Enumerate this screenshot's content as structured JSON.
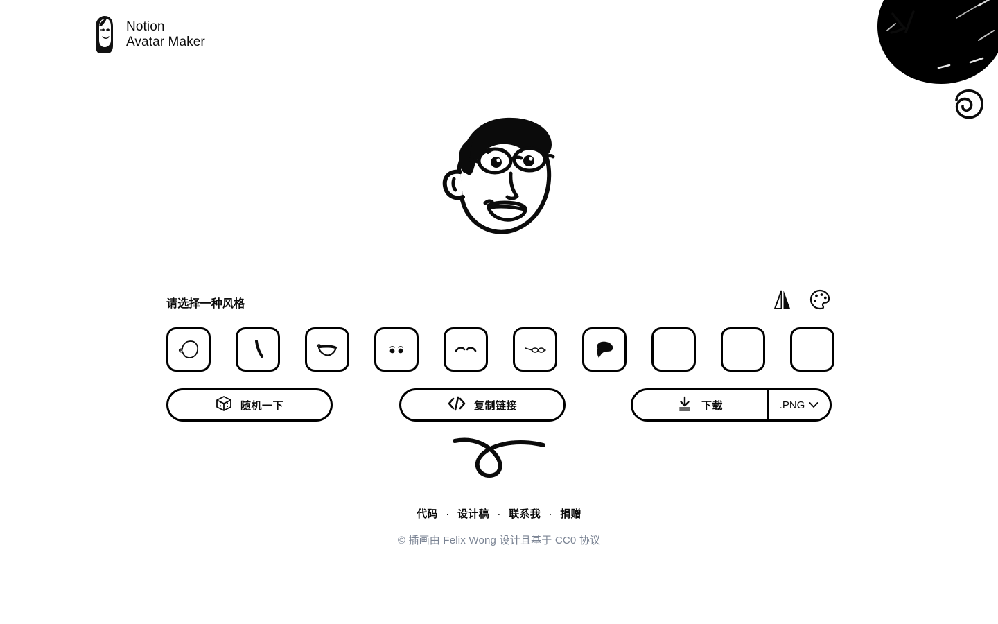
{
  "brand": {
    "logo_icon": "notion-avatar-logo",
    "line1": "Notion",
    "line2": "Avatar Maker"
  },
  "preview": {
    "name": "avatar-preview",
    "description": "hand-drawn face with swept hair, glasses and smile"
  },
  "panel": {
    "title": "请选择一种风格",
    "tools": [
      {
        "name": "flip-icon",
        "label": "翻转"
      },
      {
        "name": "palette-icon",
        "label": "调色"
      }
    ],
    "chips": [
      {
        "name": "style-chip-face",
        "icon": "face-icon"
      },
      {
        "name": "style-chip-nose",
        "icon": "nose-icon"
      },
      {
        "name": "style-chip-mouth",
        "icon": "mouth-icon"
      },
      {
        "name": "style-chip-eyes",
        "icon": "eyes-icon"
      },
      {
        "name": "style-chip-eyebrows",
        "icon": "eyebrows-icon"
      },
      {
        "name": "style-chip-glasses",
        "icon": "glasses-icon"
      },
      {
        "name": "style-chip-hair",
        "icon": "hair-icon"
      },
      {
        "name": "style-chip-beard",
        "icon": "empty-icon"
      },
      {
        "name": "style-chip-accessory",
        "icon": "empty-icon"
      },
      {
        "name": "style-chip-details",
        "icon": "empty-icon"
      }
    ]
  },
  "actions": {
    "random_label": "随机一下",
    "random_icon": "dice-icon",
    "copy_label": "复制链接",
    "copy_icon": "code-icon",
    "download_label": "下载",
    "download_icon": "download-icon",
    "format_value": ".PNG",
    "format_caret_icon": "chevron-down-icon"
  },
  "footer": {
    "links": [
      "代码",
      "设计稿",
      "联系我",
      "捐赠"
    ],
    "separator": "·",
    "copyright": "© 插画由 Felix Wong 设计且基于 CC0 协议"
  },
  "decorations": [
    {
      "name": "ink-blob-decoration"
    },
    {
      "name": "tick-marks-decoration"
    },
    {
      "name": "spiral-decoration"
    },
    {
      "name": "loop-flourish-decoration"
    }
  ],
  "colors": {
    "ink": "#0b0b0b",
    "background": "#ffffff",
    "muted_text": "#7b8494"
  }
}
